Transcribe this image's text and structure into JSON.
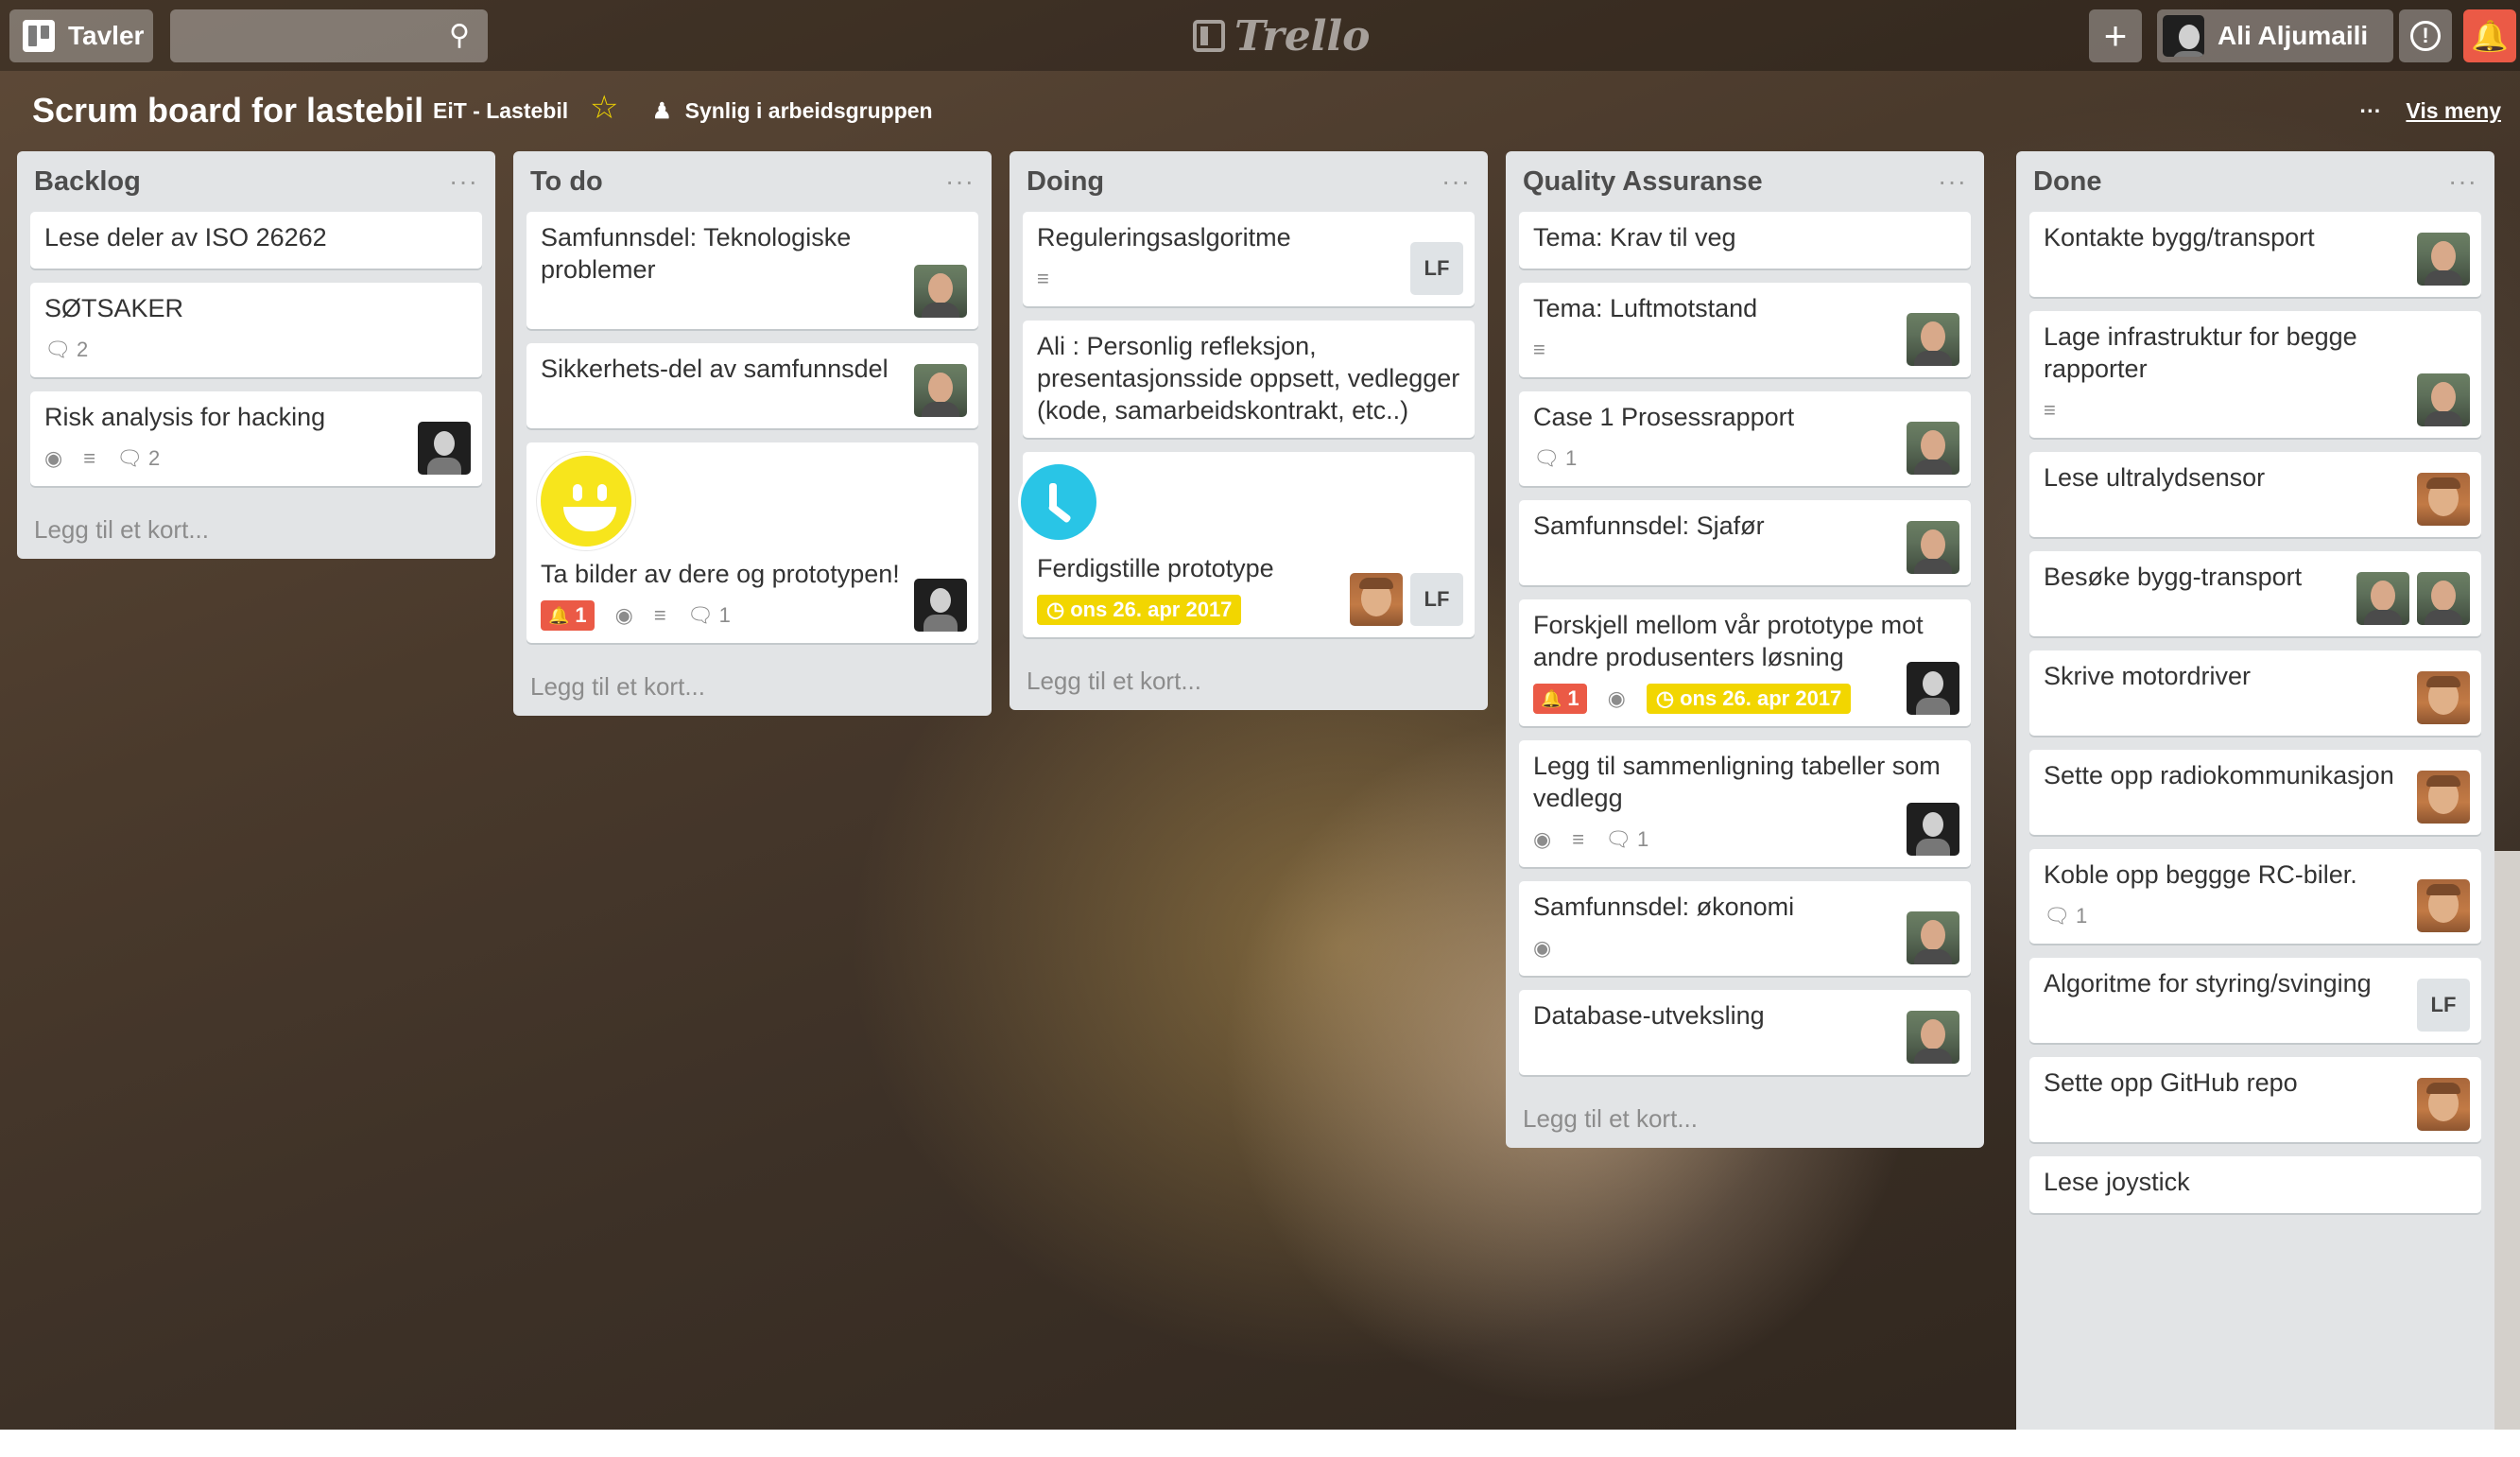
{
  "header": {
    "boards_label": "Tavler",
    "search_placeholder": "",
    "logo_text": "Trello",
    "user_name": "Ali Aljumaili",
    "add_icon": "plus-icon",
    "info_icon": "info-icon",
    "bell_icon": "bell-icon"
  },
  "board": {
    "title": "Scrum board for lastebil",
    "team": "EiT - Lastebil",
    "visibility": "Synlig i arbeidsgruppen",
    "menu_dots": "···",
    "menu_label": "Vis meny"
  },
  "colors": {
    "alert": "#eb5a46",
    "due": "#f2d600",
    "list_bg": "#e2e4e6"
  },
  "lists": [
    {
      "title": "Backlog",
      "menu": "···",
      "add_card": "Legg til et kort...",
      "cards": [
        {
          "title": "Lese deler av ISO 26262"
        },
        {
          "title": "SØTSAKER",
          "comments": "2"
        },
        {
          "title": "Risk analysis for hacking",
          "watch": true,
          "desc": true,
          "comments": "2",
          "members": [
            "dark"
          ]
        }
      ]
    },
    {
      "title": "To do",
      "menu": "···",
      "add_card": "Legg til et kort...",
      "cards": [
        {
          "title": "Samfunnsdel: Teknologiske problemer",
          "members": [
            "photo"
          ]
        },
        {
          "title": "Sikkerhets-del av samfunnsdel",
          "members": [
            "photo"
          ]
        },
        {
          "title": "Ta bilder av dere og prototypen!",
          "sticker": "smiley",
          "alert": "1",
          "watch": true,
          "desc": true,
          "comments": "1",
          "members": [
            "dark"
          ]
        }
      ]
    },
    {
      "title": "Doing",
      "menu": "···",
      "add_card": "Legg til et kort...",
      "cards": [
        {
          "title": "Reguleringsaslgoritme",
          "desc": true,
          "members": [
            "LF"
          ]
        },
        {
          "title": "Ali : Personlig refleksjon, presentasjonsside oppsett, vedlegger (kode, samarbeidskontrakt, etc..)"
        },
        {
          "title": "Ferdigstille prototype",
          "sticker": "clock",
          "due": "ons 26. apr 2017",
          "members": [
            "photo2",
            "LF"
          ]
        }
      ]
    },
    {
      "title": "Quality Assuranse",
      "menu": "···",
      "add_card": "Legg til et kort...",
      "cards": [
        {
          "title": "Tema: Krav til veg"
        },
        {
          "title": "Tema: Luftmotstand",
          "desc": true,
          "members": [
            "photo"
          ]
        },
        {
          "title": "Case 1 Prosessrapport",
          "comments": "1",
          "members": [
            "photo"
          ]
        },
        {
          "title": "Samfunnsdel: Sjafør",
          "members": [
            "photo"
          ]
        },
        {
          "title": "Forskjell mellom vår prototype mot andre produsenters løsning",
          "alert": "1",
          "watch": true,
          "due": "ons 26. apr 2017",
          "members": [
            "dark"
          ]
        },
        {
          "title": "Legg til sammenligning tabeller som vedlegg",
          "watch": true,
          "desc": true,
          "comments": "1",
          "members": [
            "dark"
          ]
        },
        {
          "title": "Samfunnsdel: økonomi",
          "watch": true,
          "members": [
            "photo"
          ]
        },
        {
          "title": "Database-utveksling",
          "members": [
            "photo"
          ]
        }
      ]
    },
    {
      "title": "Done",
      "menu": "···",
      "add_card": "",
      "cards": [
        {
          "title": "Kontakte bygg/transport",
          "members": [
            "photo"
          ]
        },
        {
          "title": "Lage infrastruktur for begge rapporter",
          "desc": true,
          "members": [
            "photo"
          ]
        },
        {
          "title": "Lese ultralydsensor",
          "members": [
            "photo2"
          ]
        },
        {
          "title": "Besøke bygg-transport",
          "members": [
            "photo",
            "photo"
          ]
        },
        {
          "title": "Skrive motordriver",
          "members": [
            "photo2"
          ]
        },
        {
          "title": "Sette opp radiokommunikasjon",
          "members": [
            "photo2"
          ]
        },
        {
          "title": "Koble opp beggge RC-biler.",
          "comments": "1",
          "members": [
            "photo2"
          ]
        },
        {
          "title": "Algoritme for styring/svinging",
          "members": [
            "LF"
          ]
        },
        {
          "title": "Sette opp GitHub repo",
          "members": [
            "photo2"
          ]
        },
        {
          "title": "Lese joystick"
        }
      ]
    }
  ]
}
